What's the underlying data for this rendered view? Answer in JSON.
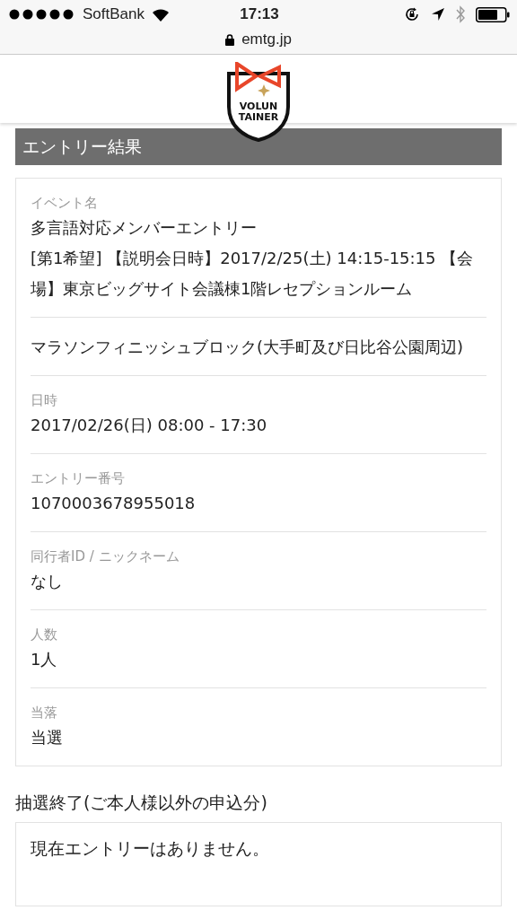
{
  "status_bar": {
    "carrier": "SoftBank",
    "time": "17:13"
  },
  "address_bar": {
    "url": "emtg.jp"
  },
  "logo": {
    "lines": [
      "VOLUN",
      "TAINER"
    ]
  },
  "section": {
    "title": "エントリー結果"
  },
  "fields": [
    {
      "label": "イベント名",
      "values": [
        "多言語対応メンバーエントリー",
        "[第1希望] 【説明会日時】2017/2/25(土) 14:15-15:15 【会場】東京ビッグサイト会議棟1階レセプションルーム"
      ]
    },
    {
      "values": [
        "マラソンフィニッシュブロック(大手町及び日比谷公園周辺)"
      ]
    },
    {
      "label": "日時",
      "values": [
        "2017/02/26(日) 08:00 - 17:30"
      ]
    },
    {
      "label": "エントリー番号",
      "values": [
        "1070003678955018"
      ]
    },
    {
      "label": "同行者ID / ニックネーム",
      "values": [
        "なし"
      ]
    },
    {
      "label": "人数",
      "values": [
        "1人"
      ]
    },
    {
      "label": "当落",
      "values": [
        "当選"
      ]
    }
  ],
  "other": {
    "title": "抽選終了(ご本人様以外の申込分)",
    "message": "現在エントリーはありません。"
  }
}
